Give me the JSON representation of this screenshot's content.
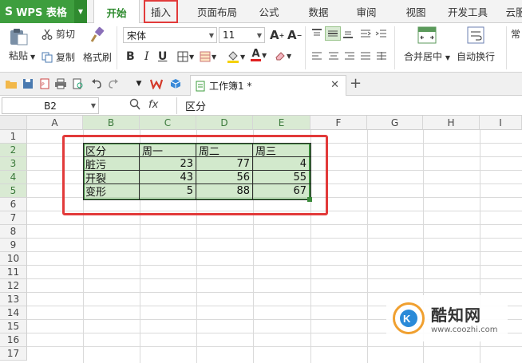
{
  "app": {
    "title": "WPS 表格",
    "logo_glyph": "S"
  },
  "tabs": [
    {
      "label": "开始",
      "active": true
    },
    {
      "label": "插入",
      "highlighted": true
    },
    {
      "label": "页面布局"
    },
    {
      "label": "公式"
    },
    {
      "label": "数据"
    },
    {
      "label": "审阅"
    },
    {
      "label": "视图"
    },
    {
      "label": "开发工具"
    },
    {
      "label": "云服"
    }
  ],
  "ribbon": {
    "paste": "粘贴",
    "cut": "剪切",
    "copy": "复制",
    "format_painter": "格式刷",
    "font_name": "宋体",
    "font_size": "11",
    "bold": "B",
    "italic": "I",
    "underline": "U",
    "merge_center": "合并居中",
    "wrap_text": "自动换行",
    "number_format": "常"
  },
  "document_tab": {
    "name": "工作簿1 *"
  },
  "formula_bar": {
    "name_box": "B2",
    "fx_label": "fx",
    "content": "区分"
  },
  "columns": [
    "A",
    "B",
    "C",
    "D",
    "E",
    "F",
    "G",
    "H",
    "I"
  ],
  "rows": [
    "1",
    "2",
    "3",
    "4",
    "5",
    "6",
    "7",
    "8",
    "9",
    "10",
    "11",
    "12",
    "13",
    "14",
    "15",
    "16",
    "17"
  ],
  "table": {
    "header": [
      "区分",
      "周一",
      "周二",
      "周三"
    ],
    "rows": [
      [
        "脏污",
        "23",
        "77",
        "4"
      ],
      [
        "开裂",
        "43",
        "56",
        "55"
      ],
      [
        "变形",
        "5",
        "88",
        "67"
      ]
    ]
  },
  "watermark": {
    "title": "酷知网",
    "url": "www.coozhi.com"
  },
  "colors": {
    "accent": "#3e9e3e",
    "selection": "#9cce8e",
    "highlight_box": "#e23a3a"
  }
}
